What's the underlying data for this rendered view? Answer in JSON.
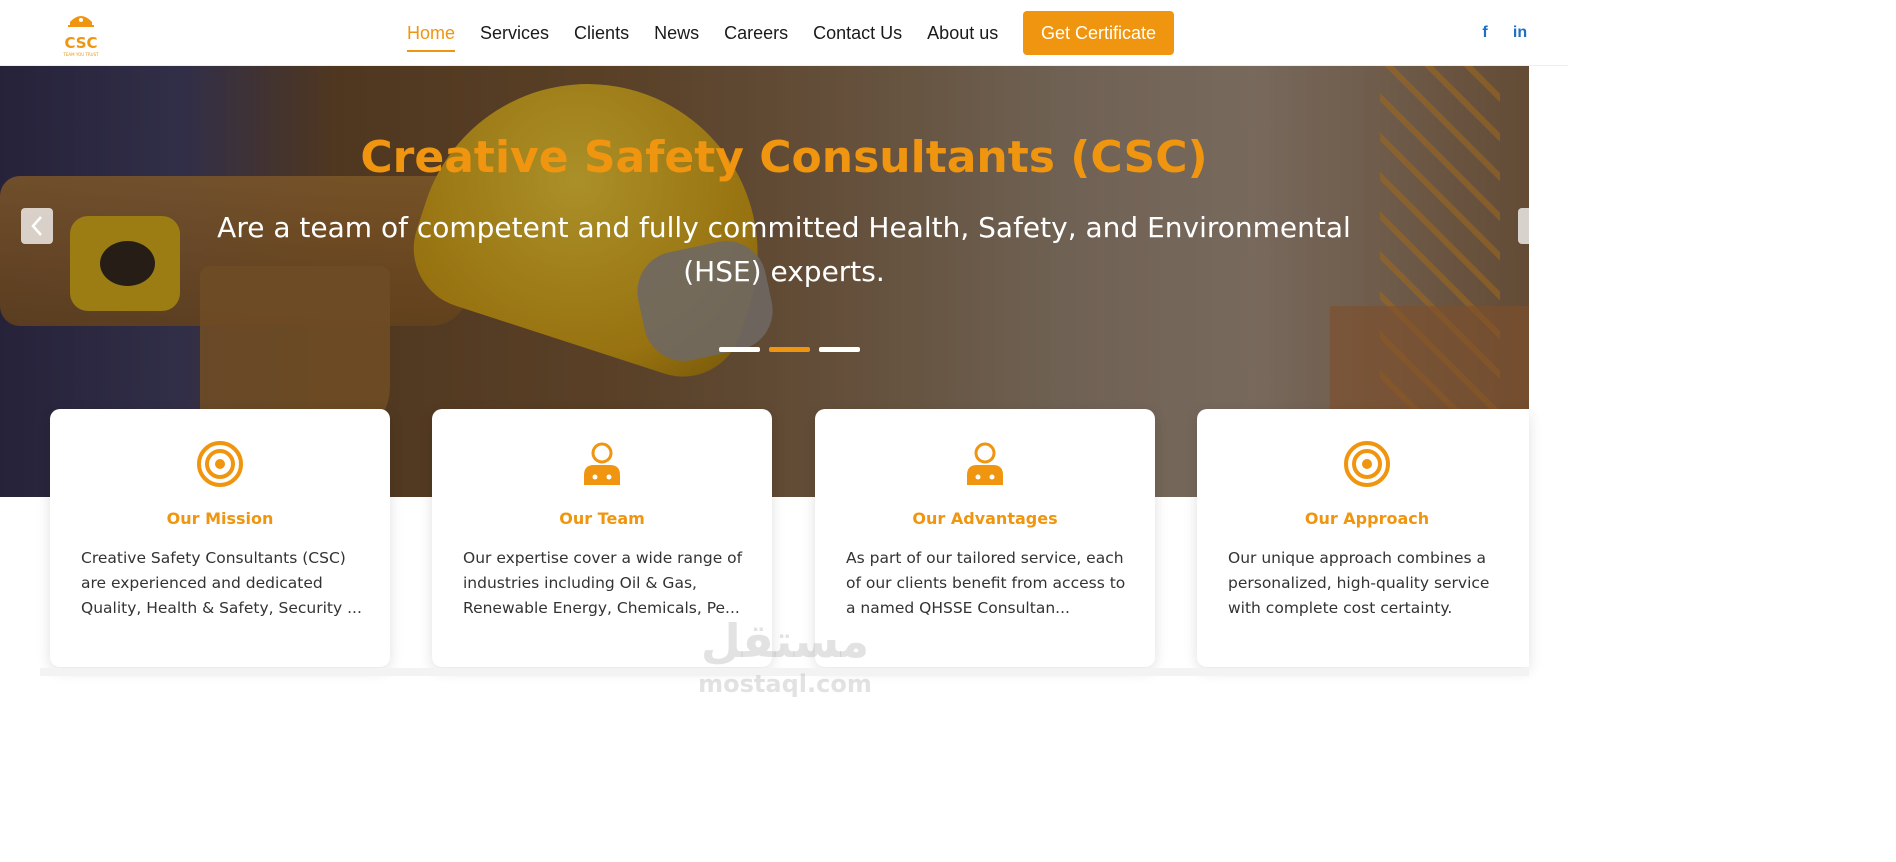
{
  "header": {
    "logo_text": "CSC",
    "logo_tagline": "TEAM YOU TRUST",
    "nav": [
      {
        "label": "Home",
        "active": true
      },
      {
        "label": "Services",
        "active": false
      },
      {
        "label": "Clients",
        "active": false
      },
      {
        "label": "News",
        "active": false
      },
      {
        "label": "Careers",
        "active": false
      },
      {
        "label": "Contact Us",
        "active": false
      },
      {
        "label": "About us",
        "active": false
      }
    ],
    "cta_label": "Get Certificate",
    "social": [
      {
        "icon": "facebook-icon",
        "glyph": "f"
      },
      {
        "icon": "linkedin-icon",
        "glyph": "in"
      }
    ]
  },
  "hero": {
    "title": "Creative Safety Consultants (CSC)",
    "subtitle": "Are a team of competent and fully committed Health, Safety, and Environmental (HSE) experts.",
    "active_slide": 2,
    "slide_count": 3
  },
  "cards": [
    {
      "icon": "target-icon",
      "title": "Our Mission",
      "text": "Creative Safety Consultants (CSC) are experienced and dedicated Quality, Health & Safety, Security ..."
    },
    {
      "icon": "user-team-icon",
      "title": "Our Team",
      "text": "Our expertise cover a wide range of industries including Oil & Gas, Renewable Energy, Chemicals, Pe..."
    },
    {
      "icon": "user-advisor-icon",
      "title": "Our Advantages",
      "text": "As part of our tailored service, each of our clients benefit from access to a named QHSSE Consultan..."
    },
    {
      "icon": "target-icon",
      "title": "Our Approach",
      "text": "Our unique approach combines a personalized, high-quality service with complete cost certainty."
    }
  ],
  "watermark": {
    "arabic": "مستقل",
    "latin": "mostaql.com"
  },
  "colors": {
    "accent": "#f0950f",
    "social": "#1f6fc4",
    "text": "#333333"
  }
}
